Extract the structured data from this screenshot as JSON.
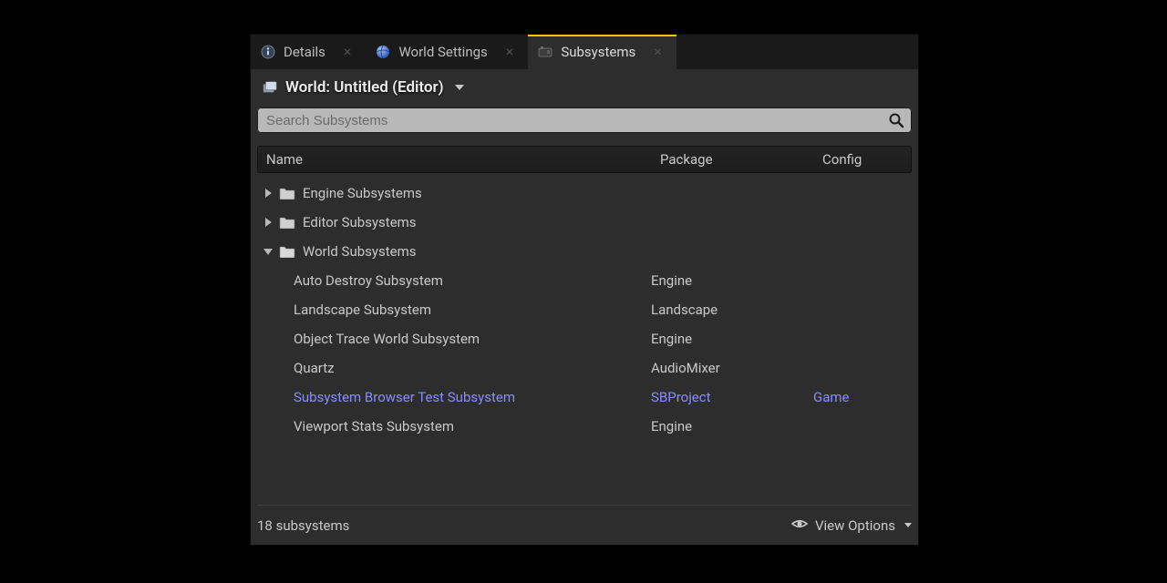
{
  "tabs": [
    {
      "label": "Details",
      "icon": "info"
    },
    {
      "label": "World Settings",
      "icon": "globe"
    },
    {
      "label": "Subsystems",
      "icon": "engine"
    }
  ],
  "active_tab": 2,
  "title": "World: Untitled (Editor)",
  "search": {
    "placeholder": "Search Subsystems"
  },
  "columns": {
    "name": "Name",
    "package": "Package",
    "config": "Config"
  },
  "tree": [
    {
      "type": "group",
      "expanded": false,
      "label": "Engine Subsystems"
    },
    {
      "type": "group",
      "expanded": false,
      "label": "Editor Subsystems"
    },
    {
      "type": "group",
      "expanded": true,
      "label": "World Subsystems",
      "children": [
        {
          "name": "Auto Destroy Subsystem",
          "package": "Engine",
          "config": "",
          "highlight": false
        },
        {
          "name": "Landscape Subsystem",
          "package": "Landscape",
          "config": "",
          "highlight": false
        },
        {
          "name": "Object Trace World Subsystem",
          "package": "Engine",
          "config": "",
          "highlight": false
        },
        {
          "name": "Quartz",
          "package": "AudioMixer",
          "config": "",
          "highlight": false
        },
        {
          "name": "Subsystem Browser Test Subsystem",
          "package": "SBProject",
          "config": "Game",
          "highlight": true
        },
        {
          "name": "Viewport Stats Subsystem",
          "package": "Engine",
          "config": "",
          "highlight": false
        }
      ]
    }
  ],
  "footer": {
    "count_label": "18 subsystems",
    "view_options_label": "View Options"
  }
}
